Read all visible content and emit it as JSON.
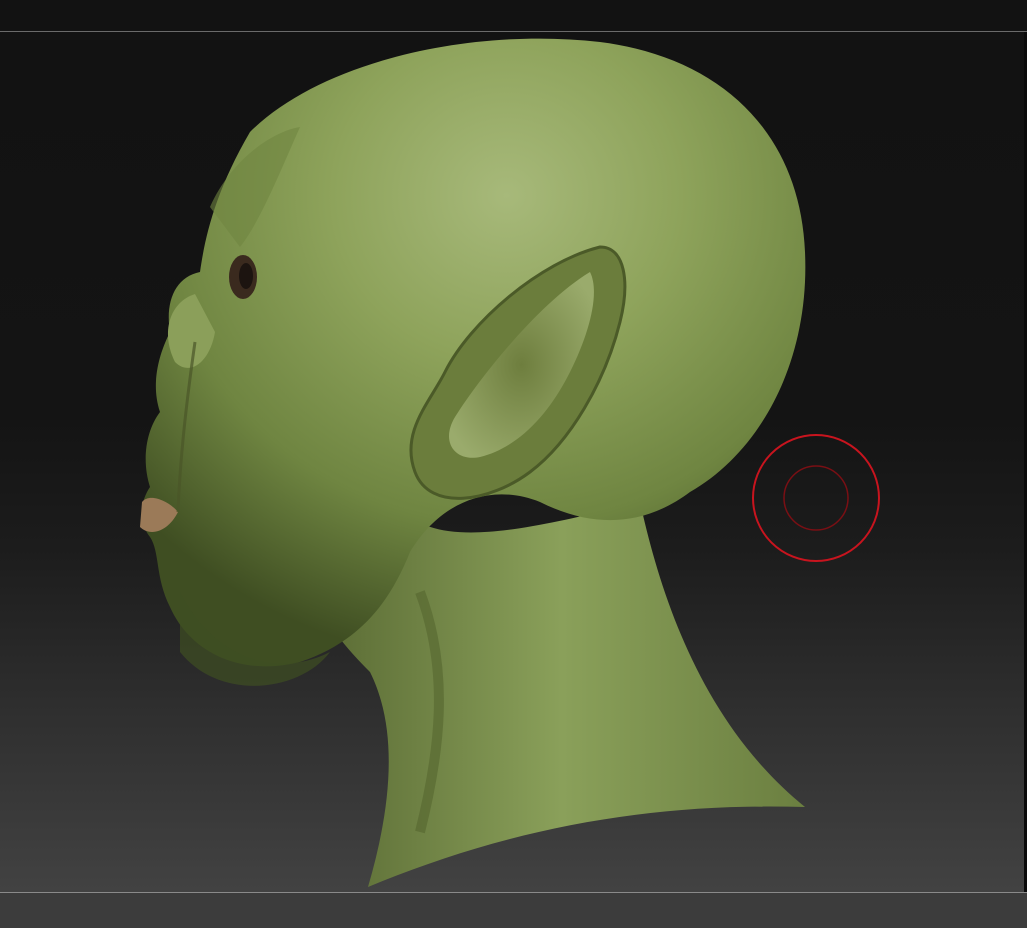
{
  "viewport": {
    "background_top": "#121212",
    "background_bottom": "#424242",
    "model_color": "#7f9a4a",
    "brush_color": "#c8141e"
  },
  "model": {
    "subject": "green-creature-head-profile"
  }
}
